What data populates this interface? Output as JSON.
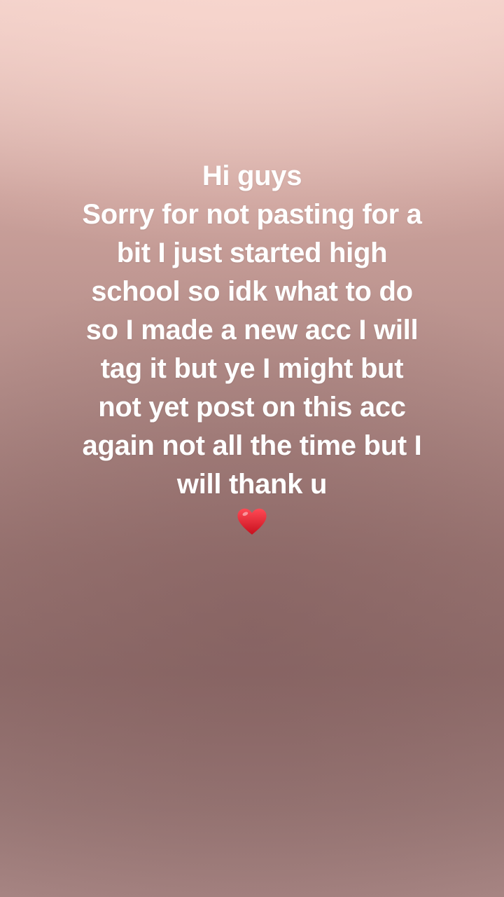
{
  "story": {
    "lines": [
      "Hi guys",
      "Sorry for not pasting for a",
      "bit I just started high",
      "school so idk what to do",
      "so I made a new acc I will",
      "tag it but ye I might but",
      "not yet post on this acc",
      "again not all the time but I",
      "will thank u"
    ],
    "emoji": "heart-icon",
    "colors": {
      "text": "#ffffff",
      "heart": "#e0202e",
      "background_top": "#f0cfc8",
      "background_bottom": "#8f6c6a"
    }
  }
}
